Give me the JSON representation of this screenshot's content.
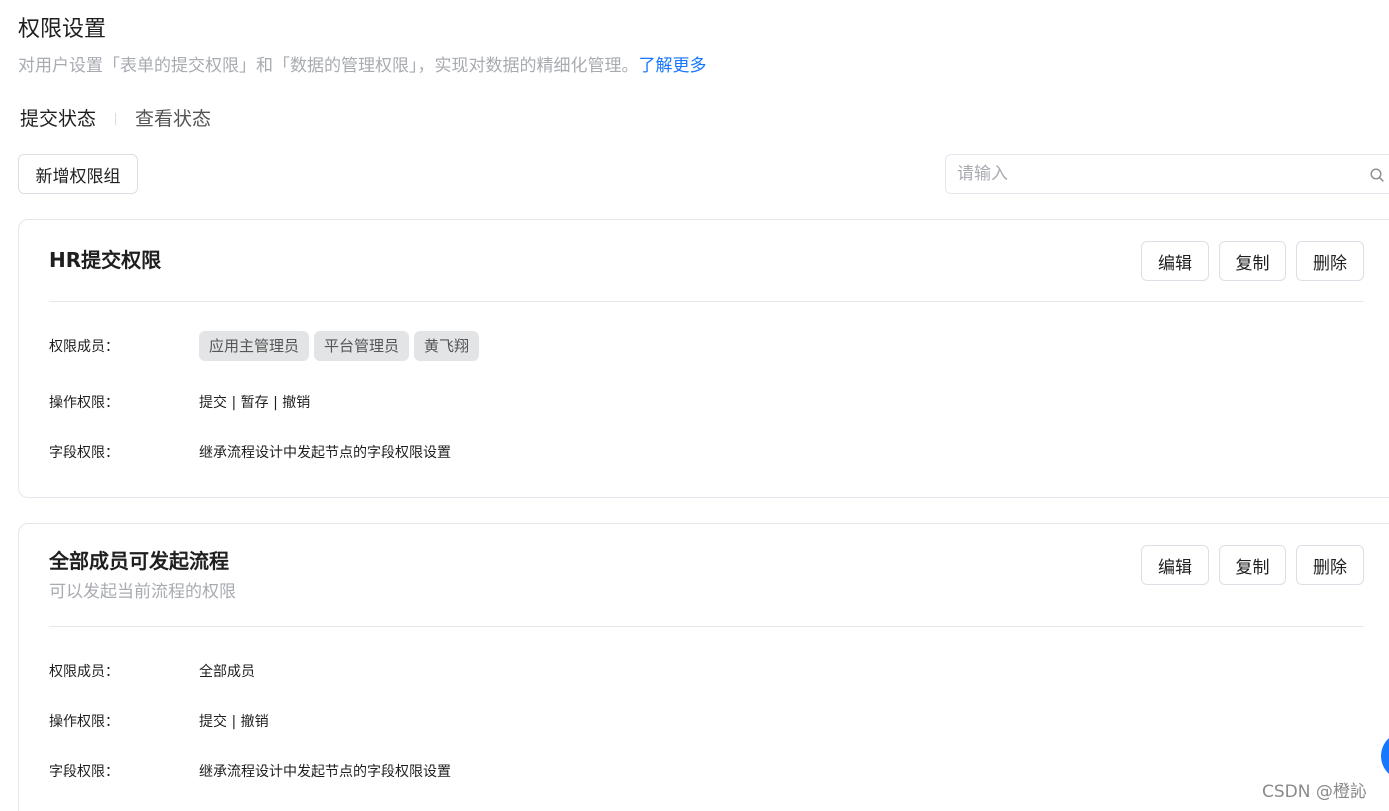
{
  "header": {
    "title": "权限设置",
    "description": "对用户设置「表单的提交权限」和「数据的管理权限」，实现对数据的精细化管理。",
    "learn_more": "了解更多"
  },
  "tabs": [
    {
      "label": "提交状态",
      "active": true
    },
    {
      "label": "查看状态",
      "active": false
    }
  ],
  "toolbar": {
    "add_group_label": "新增权限组",
    "search_placeholder": "请输入",
    "search_value": ""
  },
  "labels": {
    "members": "权限成员：",
    "operations": "操作权限：",
    "fields": "字段权限："
  },
  "actions": {
    "edit": "编辑",
    "copy": "复制",
    "delete": "删除"
  },
  "groups": [
    {
      "title": "HR提交权限",
      "subtitle": "",
      "members": [
        "应用主管理员",
        "平台管理员",
        "黄飞翔"
      ],
      "operations": "提交 | 暂存 | 撤销",
      "fields": "继承流程设计中发起节点的字段权限设置"
    },
    {
      "title": "全部成员可发起流程",
      "subtitle": "可以发起当前流程的权限",
      "members_text": "全部成员",
      "operations": "提交 | 撤销",
      "fields": "继承流程设计中发起节点的字段权限设置"
    }
  ],
  "watermark": "CSDN @橙訫",
  "colors": {
    "accent": "#1677ff",
    "muted_text": "#a8abb2",
    "tag_bg": "#e3e4e6",
    "border": "#e4e7ed"
  }
}
